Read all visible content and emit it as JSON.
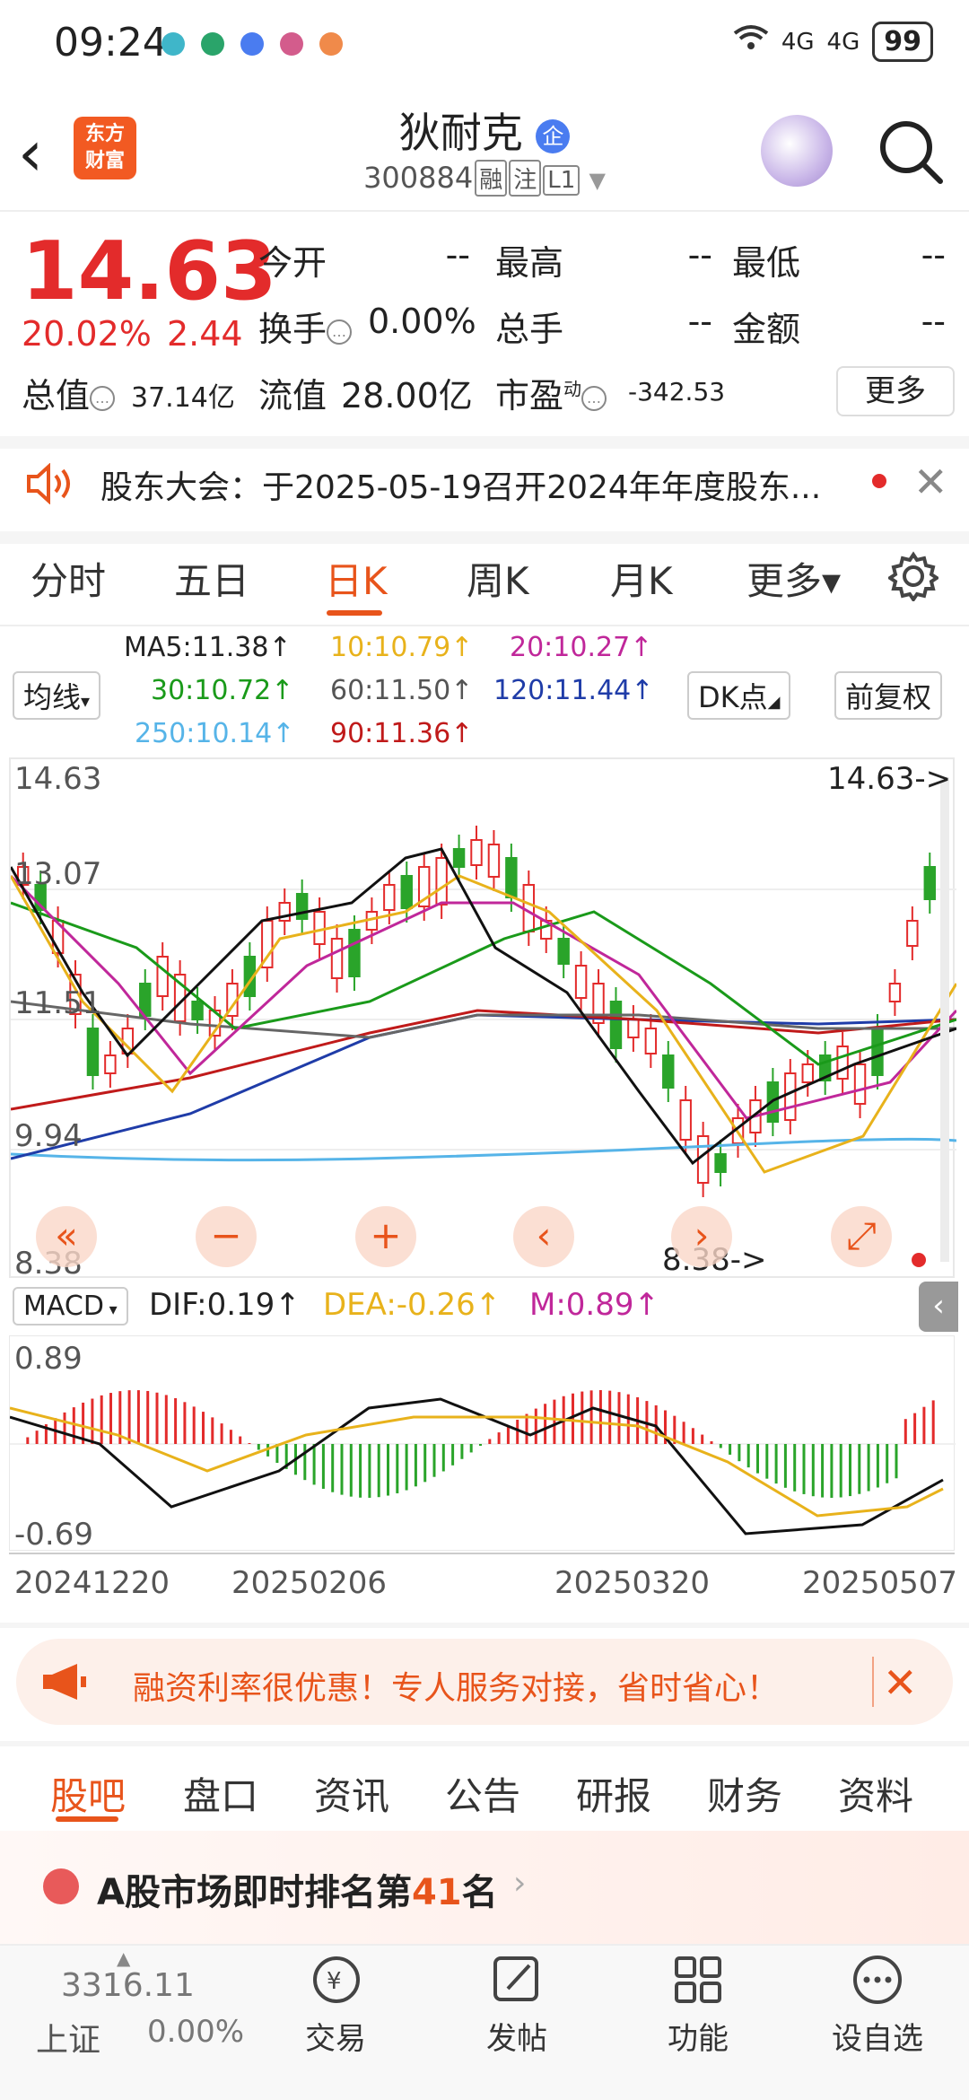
{
  "status_bar": {
    "time": "09:24",
    "network1": "4G",
    "network2": "4G",
    "battery": "99"
  },
  "header": {
    "back_glyph": "‹",
    "logo_line1": "东方",
    "logo_line2": "财富",
    "stock_name": "狄耐克",
    "badge": "企",
    "code": "300884",
    "tag_rong": "融",
    "tag_zhu": "注",
    "tag_l1": "L1"
  },
  "quote": {
    "price": "14.63",
    "change_pct": "20.02%",
    "change_amt": "2.44",
    "open_label": "今开",
    "open_val": "--",
    "high_label": "最高",
    "high_val": "--",
    "low_label": "最低",
    "low_val": "--",
    "turnover_label": "换手",
    "turnover_val": "0.00%",
    "volume_label": "总手",
    "volume_val": "--",
    "amount_label": "金额",
    "amount_val": "--",
    "mktcap_label": "总值",
    "mktcap_val": "37.14亿",
    "float_label": "流值",
    "float_val": "28.00亿",
    "pe_label": "市盈",
    "pe_sup": "动",
    "pe_val": "-342.53",
    "more_label": "更多"
  },
  "notice": {
    "text": "股东大会：于2025-05-19召开2024年年度股东..."
  },
  "period_tabs": [
    "分时",
    "五日",
    "日K",
    "周K",
    "月K",
    "更多▾"
  ],
  "ma_legend": {
    "mode_label": "均线",
    "ma5": "MA5:11.38↑",
    "ma10": "10:10.79↑",
    "ma20": "20:10.27↑",
    "ma30": "30:10.72↑",
    "ma60": "60:11.50↑",
    "ma120": "120:11.44↑",
    "ma250": "250:10.14↑",
    "ma90": "90:11.36↑",
    "dk_label": "DK点",
    "adjust_label": "前复权"
  },
  "kline": {
    "y_top": "14.63",
    "y_2": "13.07",
    "y_3": "11.51",
    "y_4": "9.94",
    "y_bottom": "8.38",
    "max_marker": "14.63->",
    "min_marker": "8.38->"
  },
  "macd": {
    "label": "MACD",
    "dif": "DIF:0.19↑",
    "dea": "DEA:-0.26↑",
    "m": "M:0.89↑",
    "y_top": "0.89",
    "y_bottom": "-0.69"
  },
  "dates": [
    "20241220",
    "20250206",
    "20250320",
    "20250507"
  ],
  "promo": {
    "text": "融资利率很优惠！专人服务对接，省时省心！"
  },
  "content_tabs": [
    "股吧",
    "盘口",
    "资讯",
    "公告",
    "研报",
    "财务",
    "资料"
  ],
  "rank": {
    "prefix": "A股市场即时排名第",
    "number": "41",
    "suffix": "名"
  },
  "bottom_nav": {
    "index_value": "3316.11",
    "index_name": "上证",
    "index_change": "0.00%",
    "items": [
      "交易",
      "发帖",
      "功能",
      "设自选"
    ]
  },
  "colors": {
    "accent": "#e8541b",
    "up": "#e32b2b",
    "down": "#2aa42a"
  }
}
